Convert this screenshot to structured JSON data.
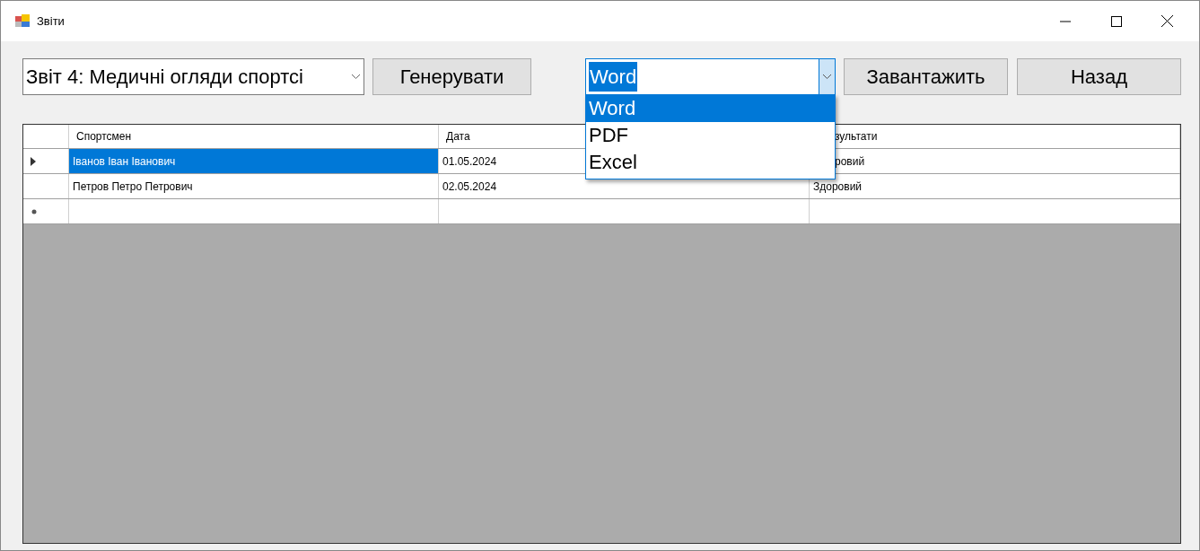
{
  "window": {
    "title": "Звіти"
  },
  "toolbar": {
    "report_select": {
      "value": "Звіт 4: Медичні огляди спортсі"
    },
    "generate_button": "Генерувати",
    "format_select": {
      "value": "Word",
      "expanded": true,
      "options": [
        {
          "label": "Word",
          "selected": true
        },
        {
          "label": "PDF",
          "selected": false
        },
        {
          "label": "Excel",
          "selected": false
        }
      ]
    },
    "download_button": "Завантажить",
    "back_button": "Назад"
  },
  "table": {
    "columns": [
      {
        "label": "Спортсмен"
      },
      {
        "label": "Дата"
      },
      {
        "label": "зультати",
        "covered": true
      }
    ],
    "rows": [
      {
        "current": true,
        "cells": [
          {
            "text": "Іванов Іван Іванович",
            "selected": true,
            "covered": false
          },
          {
            "text": "01.05.2024",
            "selected": false,
            "covered": false
          },
          {
            "text": "ровий",
            "selected": false,
            "covered": true
          }
        ]
      },
      {
        "current": false,
        "cells": [
          {
            "text": "Петров Петро Петрович",
            "selected": false,
            "covered": false
          },
          {
            "text": "02.05.2024",
            "selected": false,
            "covered": false
          },
          {
            "text": "Здоровий",
            "selected": false,
            "covered": false
          }
        ]
      }
    ],
    "new_row": true
  }
}
